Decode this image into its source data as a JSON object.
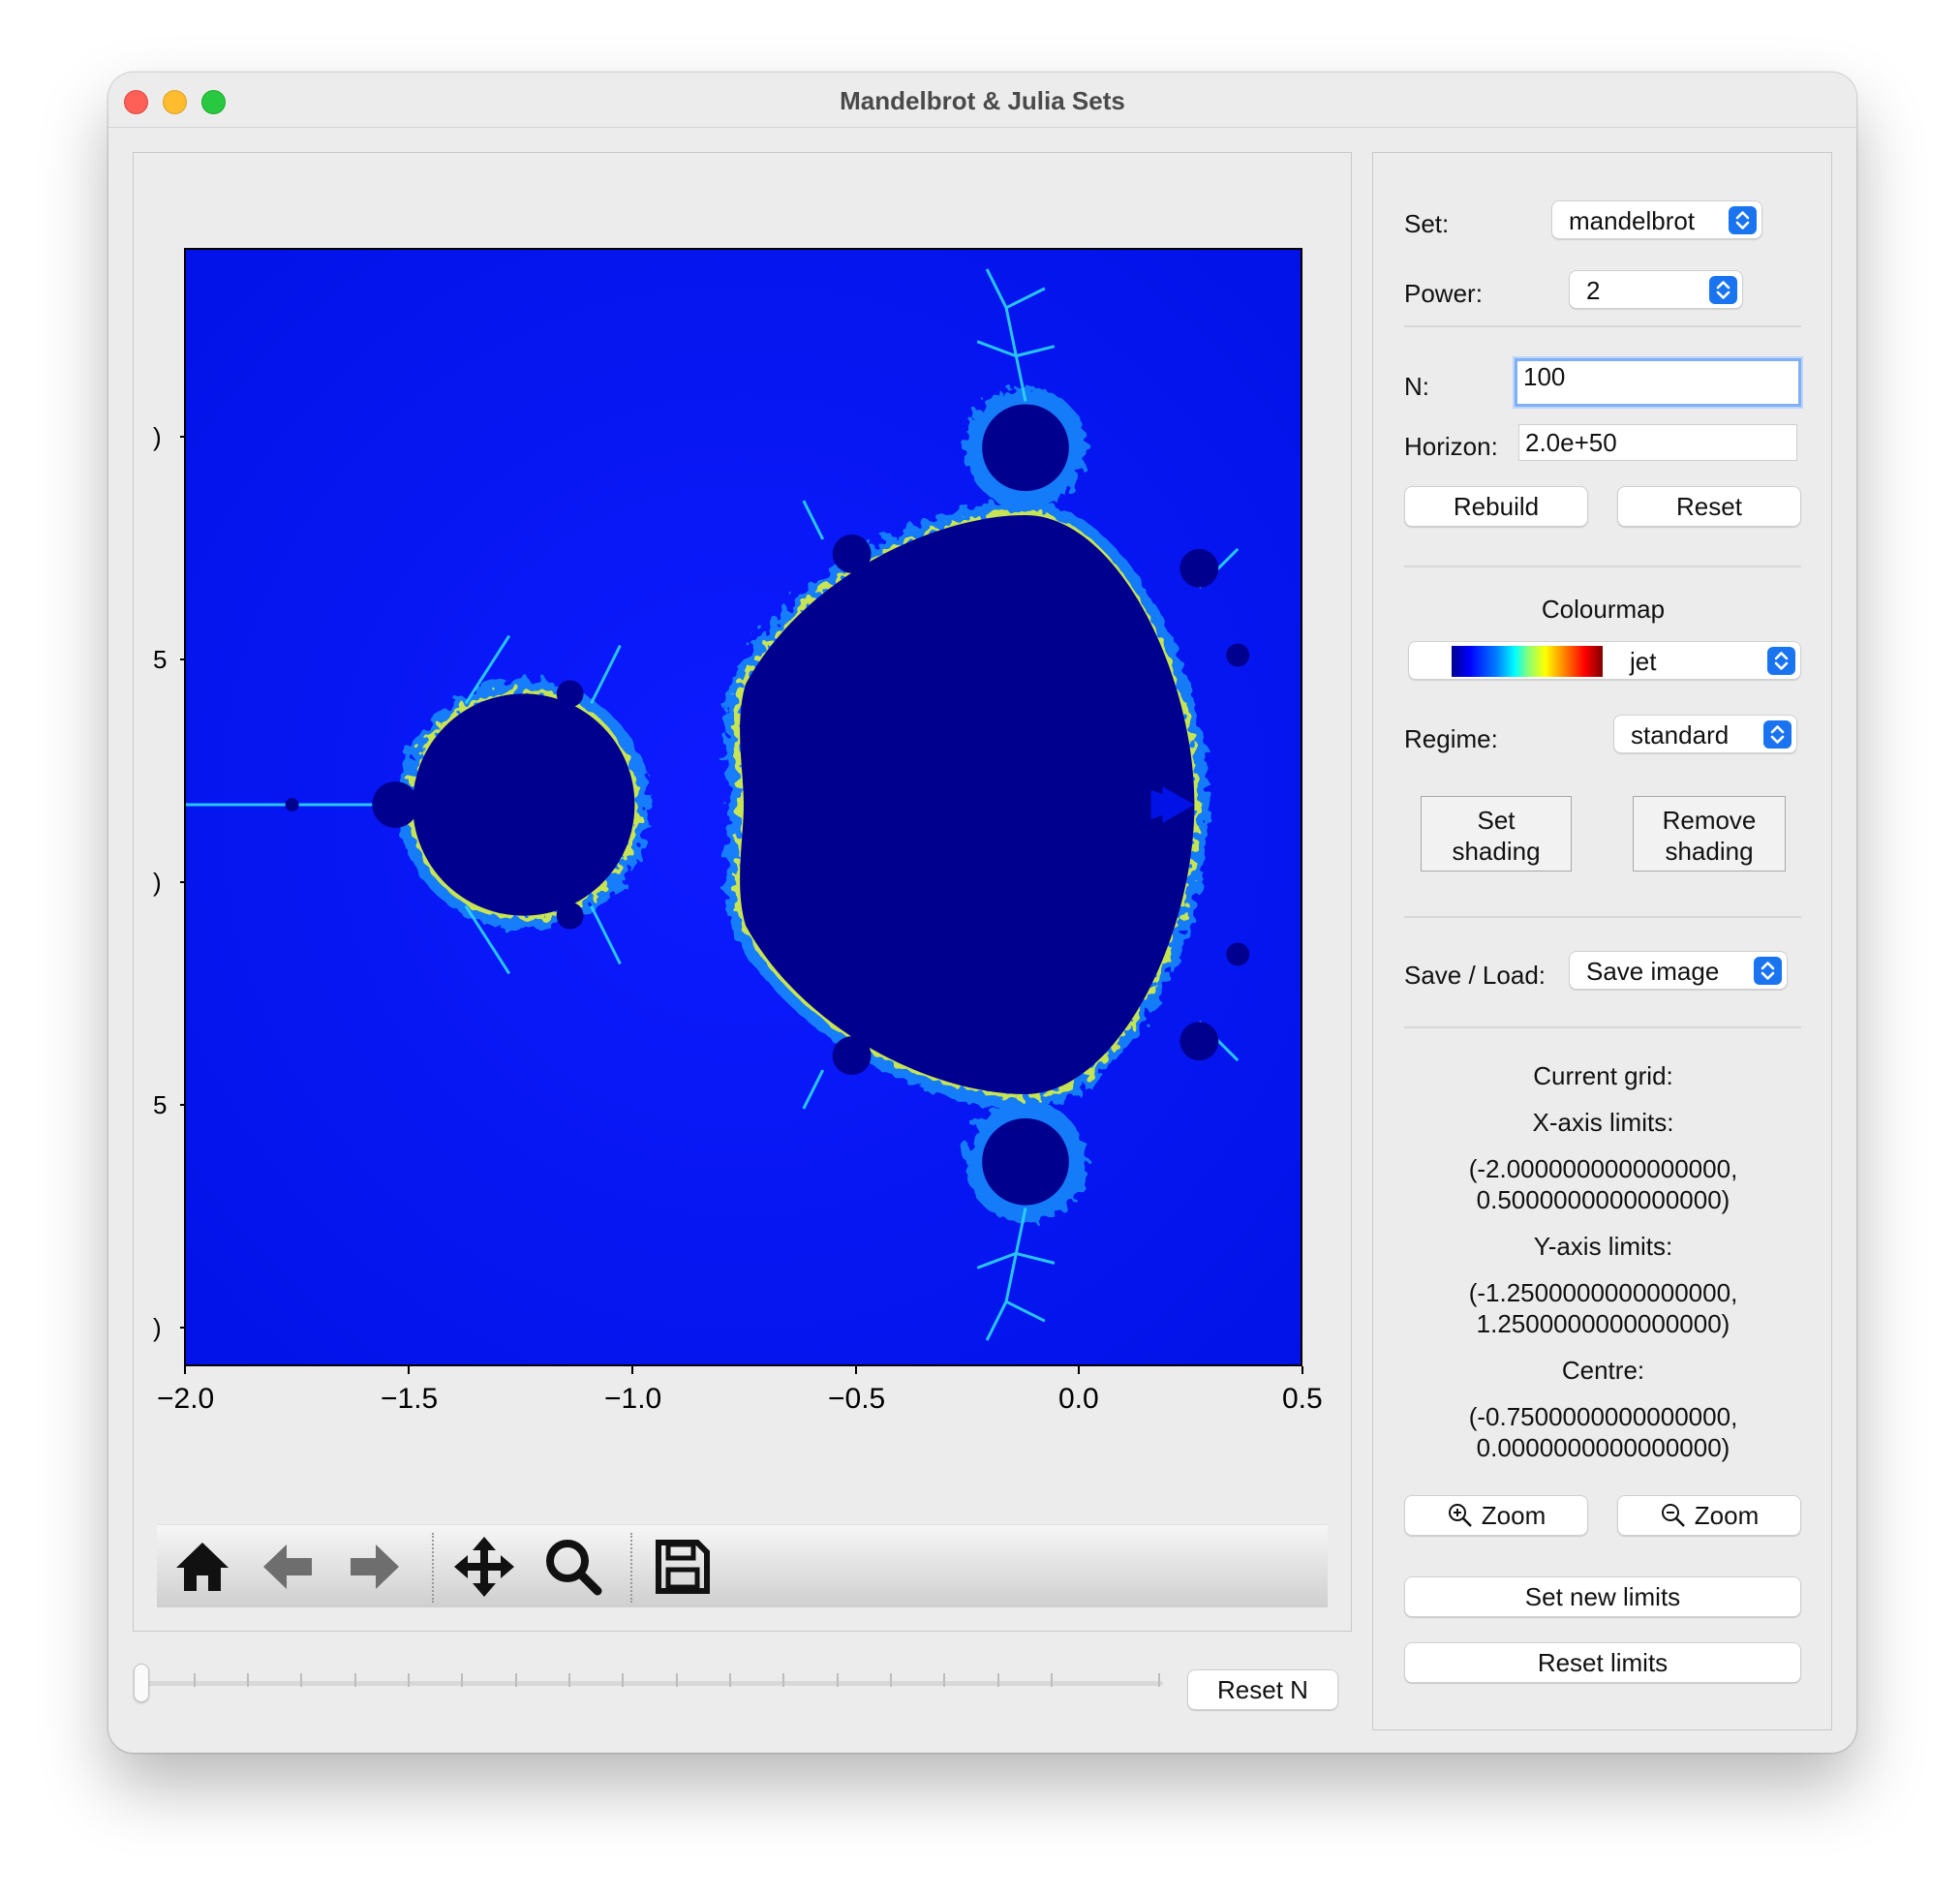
{
  "window": {
    "title": "Mandelbrot & Julia Sets"
  },
  "plot": {
    "x_ticks": [
      "−2.0",
      "−1.5",
      "−1.0",
      "−0.5",
      "0.0",
      "0.5"
    ],
    "y_ticks_cropped": [
      ")",
      "5",
      ")",
      "5",
      ")"
    ]
  },
  "toolbar": {
    "items": [
      "home-icon",
      "back-arrow-icon",
      "forward-arrow-icon",
      "pan-icon",
      "zoom-magnifier-icon",
      "save-disk-icon"
    ]
  },
  "bottom": {
    "reset_n_label": "Reset N"
  },
  "panel": {
    "set_label": "Set:",
    "set_value": "mandelbrot",
    "power_label": "Power:",
    "power_value": "2",
    "n_label": "N:",
    "n_value": "100",
    "horizon_label": "Horizon:",
    "horizon_value": "2.0e+50",
    "rebuild_label": "Rebuild",
    "reset_label": "Reset",
    "colourmap_label": "Colourmap",
    "colourmap_value": "jet",
    "regime_label": "Regime:",
    "regime_value": "standard",
    "set_shading_line1": "Set",
    "set_shading_line2": "shading",
    "remove_shading_line1": "Remove",
    "remove_shading_line2": "shading",
    "saveload_label": "Save / Load:",
    "saveload_value": "Save image",
    "current_grid": "Current grid:",
    "xlim_label": "X-axis limits:",
    "xlim_line1": "(-2.0000000000000000,",
    "xlim_line2": "0.5000000000000000)",
    "ylim_label": "Y-axis limits:",
    "ylim_line1": "(-1.2500000000000000,",
    "ylim_line2": "1.2500000000000000)",
    "centre_label": "Centre:",
    "centre_line1": "(-0.7500000000000000,",
    "centre_line2": "0.0000000000000000)",
    "zoom_in_label": "Zoom",
    "zoom_out_label": "Zoom",
    "set_new_limits_label": "Set new limits",
    "reset_limits_label": "Reset limits"
  },
  "colors": {
    "background_blue": "#0a1aff",
    "set_interior": "#00008f",
    "accent": "#1a74ef"
  }
}
